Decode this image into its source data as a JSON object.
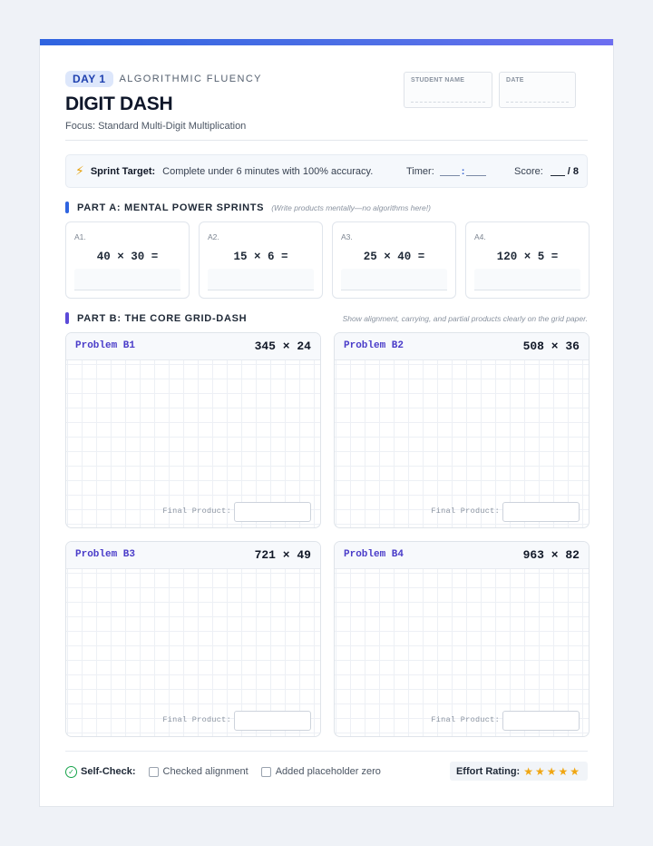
{
  "header": {
    "day": "DAY 1",
    "subject": "ALGORITHMIC FLUENCY",
    "title": "DIGIT DASH",
    "focus": "Focus: Standard Multi-Digit Multiplication",
    "student_label": "STUDENT NAME",
    "date_label": "DATE"
  },
  "target": {
    "label": "Sprint Target:",
    "text": "Complete under 6 minutes with 100% accuracy.",
    "timer_label": "Timer:",
    "timer_sep": ":",
    "score_label": "Score:",
    "score_total": "/ 8"
  },
  "part_a": {
    "title": "PART A: MENTAL POWER SPRINTS",
    "note": "(Write products mentally—no algorithms here!)",
    "items": [
      {
        "num": "A1.",
        "expr": "40 × 30 ="
      },
      {
        "num": "A2.",
        "expr": "15 × 6 ="
      },
      {
        "num": "A3.",
        "expr": "25 × 40 ="
      },
      {
        "num": "A4.",
        "expr": "120 × 5 ="
      }
    ]
  },
  "part_b": {
    "title": "PART B: THE CORE GRID-DASH",
    "note": "Show alignment, carrying, and partial products clearly on the grid paper.",
    "final_label": "Final Product:",
    "items": [
      {
        "label": "Problem B1",
        "problem": "345 × 24"
      },
      {
        "label": "Problem B2",
        "problem": "508 × 36"
      },
      {
        "label": "Problem B3",
        "problem": "721 × 49"
      },
      {
        "label": "Problem B4",
        "problem": "963 × 82"
      }
    ]
  },
  "footer": {
    "self_check": "Self-Check:",
    "checks": [
      "Checked alignment",
      "Added placeholder zero"
    ],
    "effort_label": "Effort Rating:",
    "stars": "★★★★★"
  },
  "colors": {
    "accent_blue": "#2f64e0",
    "accent_purple": "#5b4ad8",
    "star": "#f0a612",
    "check": "#16a34a"
  }
}
